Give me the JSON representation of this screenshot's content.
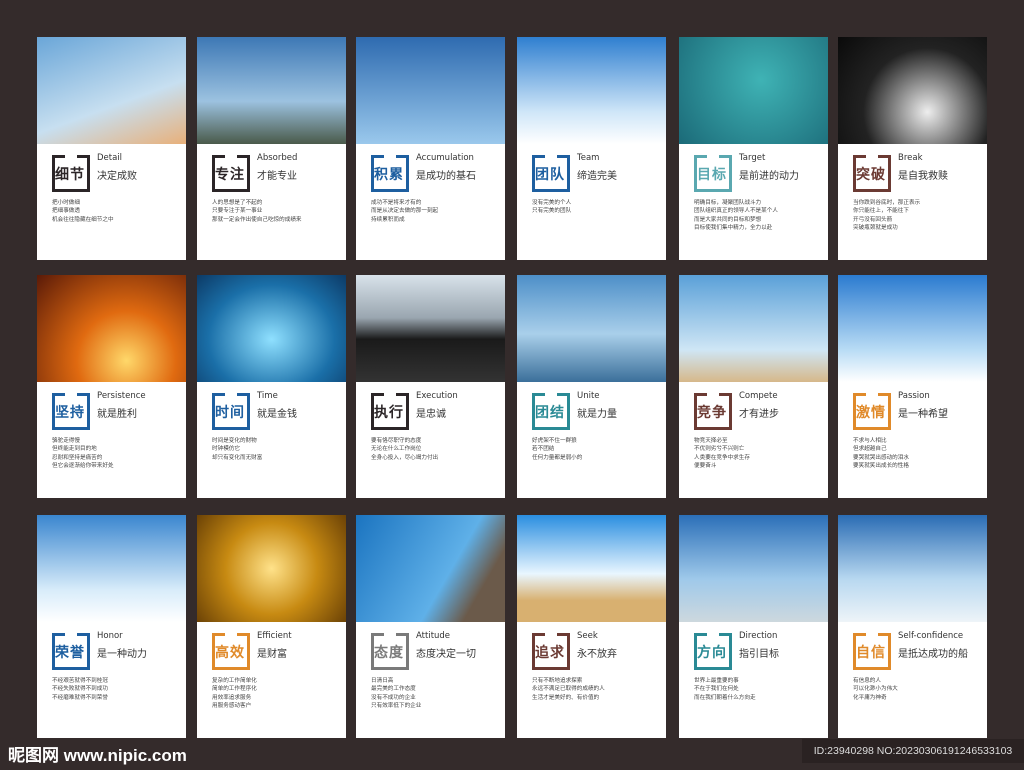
{
  "colors": {
    "black": "#2b2527",
    "blue": "#1e5fa0",
    "lightteal": "#5aa8b0",
    "teal": "#2a8a95",
    "brown": "#6b3a33",
    "orange": "#e08a2a",
    "gray": "#7a7a7a"
  },
  "cards": [
    {
      "title": "细节",
      "en": "Detail",
      "cn": "决定成败",
      "color": "#2b2527",
      "lines": [
        "把小时做细",
        "把细事做透",
        "机会往往隐藏在细节之中"
      ]
    },
    {
      "title": "专注",
      "en": "Absorbed",
      "cn": "才能专业",
      "color": "#2b2527",
      "lines": [
        "人的思想是了不起的",
        "只要专注于某一事业",
        "那就一定会作出使自己吃惊的成绩来"
      ]
    },
    {
      "title": "积累",
      "en": "Accumulation",
      "cn": "是成功的基石",
      "color": "#1e5fa0",
      "lines": [
        "成功不是将来才有的",
        "而是从决定去做的那一刻起",
        "持续累积而成"
      ]
    },
    {
      "title": "团队",
      "en": "Team",
      "cn": "缔造完美",
      "color": "#1e5fa0",
      "lines": [
        "没有完美的个人",
        "只有完美的团队"
      ]
    },
    {
      "title": "目标",
      "en": "Target",
      "cn": "是前进的动力",
      "color": "#5aa8b0",
      "lines": [
        "明确目标，凝聚团队战斗力",
        "团队组织真正的领导人不是某个人",
        "而是大家共同的目标和梦想",
        "目标使我们集中精力，全力以赴"
      ]
    },
    {
      "title": "突破",
      "en": "Break",
      "cn": "是自我救赎",
      "color": "#6b3a33",
      "lines": [
        "当你跌到谷底时，那正表示",
        "你只能往上，不能往下",
        "开弓没有回头箭",
        "突破瓶颈就是成功"
      ]
    },
    {
      "title": "坚持",
      "en": "Persistence",
      "cn": "就是胜利",
      "color": "#1e5fa0",
      "lines": [
        "骆驼走得慢",
        "但终能走到目的地",
        "忍耐和坚持是痛苦的",
        "但它会逐渐给你带来好处"
      ]
    },
    {
      "title": "时间",
      "en": "Time",
      "cn": "就是金钱",
      "color": "#1e5fa0",
      "lines": [
        "时间是变化的财物",
        "时钟模仿它",
        "却只有变化而无财富"
      ]
    },
    {
      "title": "执行",
      "en": "Execution",
      "cn": "是忠诚",
      "color": "#2b2527",
      "lines": [
        "要有恪尽职守的态度",
        "无论在什么工作岗位",
        "全身心投入，尽心竭力付出"
      ]
    },
    {
      "title": "团结",
      "en": "Unite",
      "cn": "就是力量",
      "color": "#2a8a95",
      "lines": [
        "好虎架不住一群狼",
        "若不团结",
        "任何力量都是弱小的"
      ]
    },
    {
      "title": "竞争",
      "en": "Compete",
      "cn": "才有进步",
      "color": "#6b3a33",
      "lines": [
        "物竞天择必至",
        "不优则劣兮不兴则亡",
        "人类要在竞争中求生存",
        "便要奋斗"
      ]
    },
    {
      "title": "激情",
      "en": "Passion",
      "cn": "是一种希望",
      "color": "#e08a2a",
      "lines": [
        "不求与人相比",
        "但求超越自己",
        "要哭就哭出感动的泪水",
        "要笑就笑出成长的性格"
      ]
    },
    {
      "title": "荣誉",
      "en": "Honor",
      "cn": "是一种动力",
      "color": "#1e5fa0",
      "lines": [
        "不经艰苦就得不到桂冠",
        "不经失败就得不到成功",
        "不经磨难就得不到荣誉"
      ]
    },
    {
      "title": "高效",
      "en": "Efficient",
      "cn": "是财富",
      "color": "#e08a2a",
      "lines": [
        "复杂的工作简单化",
        "简单的工作程序化",
        "用效率追求服务",
        "用服务感动客户"
      ]
    },
    {
      "title": "态度",
      "en": "Attitude",
      "cn": "态度决定一切",
      "color": "#7a7a7a",
      "lines": [
        "日清日高",
        "最完美的工作态度",
        "没有不成功的企业",
        "只有效率低下的企业"
      ]
    },
    {
      "title": "追求",
      "en": "Seek",
      "cn": "永不放弃",
      "color": "#6b3a33",
      "lines": [
        "只有不断地追求探索",
        "永远不满足已取得的成绩的人",
        "生活才是美好的、有价值的"
      ]
    },
    {
      "title": "方向",
      "en": "Direction",
      "cn": "指引目标",
      "color": "#2a8a95",
      "lines": [
        "世界上最重要的事",
        "不在于我们在何处",
        "而在我们朝着什么方向走"
      ]
    },
    {
      "title": "自信",
      "en": "Self-confidence",
      "cn": "是抵达成功的船",
      "color": "#e08a2a",
      "lines": [
        "有信息的人",
        "可以化渺小为伟大",
        "化平庸为神奇"
      ]
    }
  ],
  "footer": {
    "logo": "昵图网 www.nipic.com",
    "id": "ID:23940298 NO:20230306191246533103"
  }
}
